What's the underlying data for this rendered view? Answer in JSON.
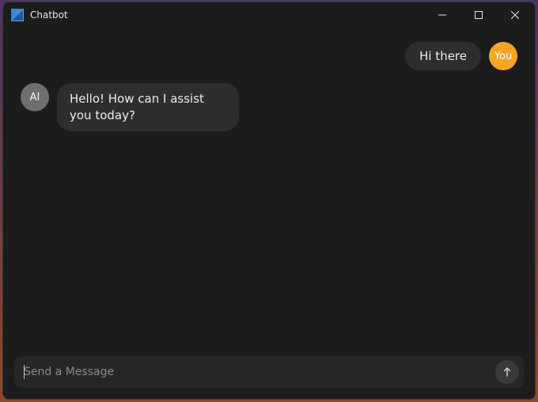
{
  "window": {
    "title": "Chatbot"
  },
  "messages": {
    "user1": {
      "sender_label": "You",
      "text": "Hi there"
    },
    "ai1": {
      "sender_label": "AI",
      "text": "Hello! How can I assist you today?"
    }
  },
  "composer": {
    "placeholder": "Send a Message",
    "value": ""
  },
  "colors": {
    "accent": "#f5a623",
    "bg": "#1c1c1c",
    "bubble": "#2e2e2e"
  }
}
